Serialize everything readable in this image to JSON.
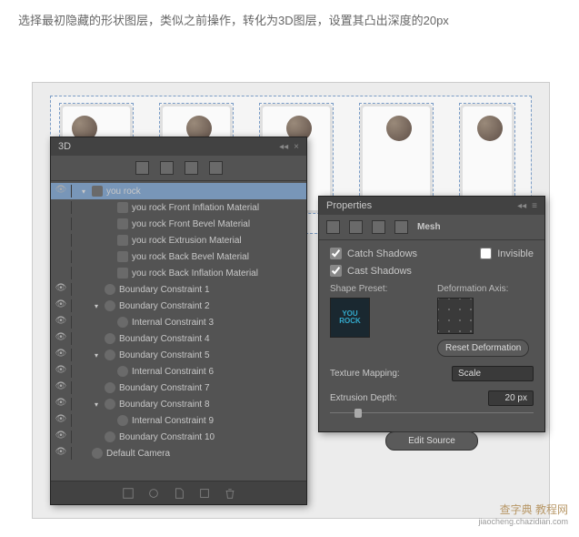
{
  "instruction": "选择最初隐藏的形状图层，类似之前操作，转化为3D图层，设置其凸出深度的20px",
  "panel3d": {
    "title": "3D",
    "items": [
      {
        "eye": true,
        "indent": 0,
        "tw": "▾",
        "icon": "sq",
        "label": "you rock",
        "sel": true
      },
      {
        "eye": false,
        "indent": 2,
        "tw": "",
        "icon": "sq",
        "label": "you rock Front Inflation Material"
      },
      {
        "eye": false,
        "indent": 2,
        "tw": "",
        "icon": "sq",
        "label": "you rock Front Bevel Material"
      },
      {
        "eye": false,
        "indent": 2,
        "tw": "",
        "icon": "sq",
        "label": "you rock Extrusion Material"
      },
      {
        "eye": false,
        "indent": 2,
        "tw": "",
        "icon": "sq",
        "label": "you rock Back Bevel Material"
      },
      {
        "eye": false,
        "indent": 2,
        "tw": "",
        "icon": "sq",
        "label": "you rock Back Inflation Material"
      },
      {
        "eye": true,
        "indent": 1,
        "tw": "",
        "icon": "rd",
        "label": "Boundary Constraint 1"
      },
      {
        "eye": true,
        "indent": 1,
        "tw": "▾",
        "icon": "rd",
        "label": "Boundary Constraint 2"
      },
      {
        "eye": true,
        "indent": 2,
        "tw": "",
        "icon": "rd",
        "label": "Internal Constraint 3"
      },
      {
        "eye": true,
        "indent": 1,
        "tw": "",
        "icon": "rd",
        "label": "Boundary Constraint 4"
      },
      {
        "eye": true,
        "indent": 1,
        "tw": "▾",
        "icon": "rd",
        "label": "Boundary Constraint 5"
      },
      {
        "eye": true,
        "indent": 2,
        "tw": "",
        "icon": "rd",
        "label": "Internal Constraint 6"
      },
      {
        "eye": true,
        "indent": 1,
        "tw": "",
        "icon": "rd",
        "label": "Boundary Constraint 7"
      },
      {
        "eye": true,
        "indent": 1,
        "tw": "▾",
        "icon": "rd",
        "label": "Boundary Constraint 8"
      },
      {
        "eye": true,
        "indent": 2,
        "tw": "",
        "icon": "rd",
        "label": "Internal Constraint 9"
      },
      {
        "eye": true,
        "indent": 1,
        "tw": "",
        "icon": "rd",
        "label": "Boundary Constraint 10"
      },
      {
        "eye": true,
        "indent": 0,
        "tw": "",
        "icon": "cam",
        "label": "Default Camera"
      }
    ]
  },
  "props": {
    "title": "Properties",
    "meshLabel": "Mesh",
    "catchShadows": "Catch Shadows",
    "castShadows": "Cast Shadows",
    "invisible": "Invisible",
    "shapePreset": "Shape Preset:",
    "deformationAxis": "Deformation Axis:",
    "resetDeformation": "Reset Deformation",
    "textureMapping": "Texture Mapping:",
    "textureValue": "Scale",
    "extrusionDepth": "Extrusion Depth:",
    "extrusionValue": "20 px",
    "editSource": "Edit Source",
    "presetText": "YOU\nROCK"
  },
  "watermark": {
    "main": "查字典 教程网",
    "sub": "jiaocheng.chazidian.com"
  }
}
